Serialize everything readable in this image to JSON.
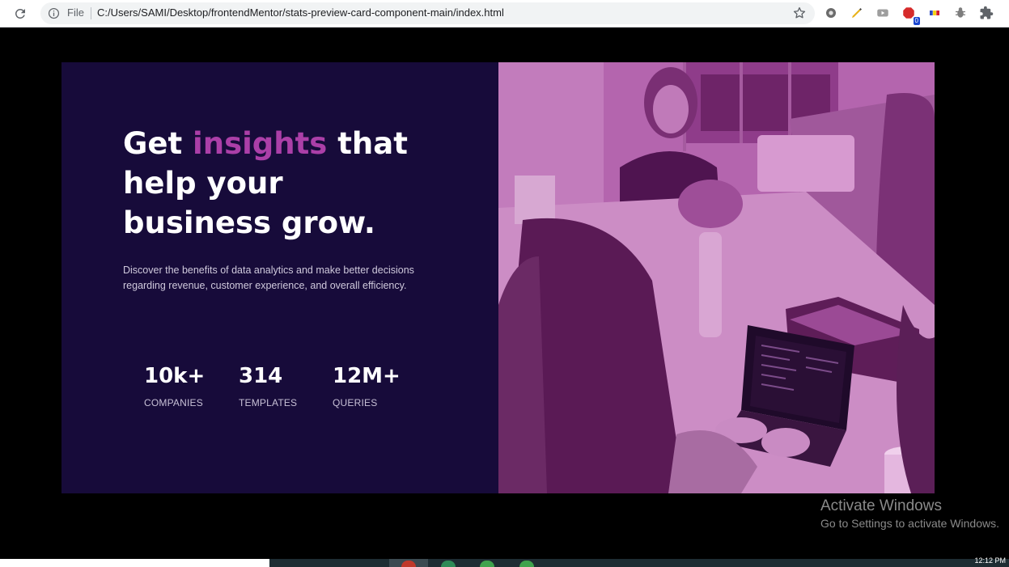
{
  "browser": {
    "file_label": "File",
    "url": "C:/Users/SAMI/Desktop/frontendMentor/stats-preview-card-component-main/index.html",
    "extension_badge": "0"
  },
  "card": {
    "headline_prefix": "Get ",
    "headline_accent": "insights",
    "headline_suffix": " that help your business grow.",
    "description": "Discover the benefits of data analytics and make better decisions regarding revenue, customer experience, and overall efficiency.",
    "stats": [
      {
        "value": "10k+",
        "label": "COMPANIES"
      },
      {
        "value": "314",
        "label": "TEMPLATES"
      },
      {
        "value": "12M+",
        "label": "QUERIES"
      }
    ],
    "colors": {
      "card_bg": "#170b3a",
      "accent": "#ab3fa8",
      "image_overlay": "#aa5ca5"
    }
  },
  "watermark": {
    "title": "Activate Windows",
    "subtitle": "Go to Settings to activate Windows."
  },
  "taskbar": {
    "clock": "12:12 PM"
  },
  "icons": {
    "reload": "reload-icon",
    "info": "info-icon",
    "star": "star-icon",
    "extensions": [
      "settings-extension-icon",
      "pencil-extension-icon",
      "youtube-extension-icon",
      "adblock-extension-icon",
      "flag-extension-icon",
      "bug-extension-icon",
      "puzzle-icon"
    ]
  }
}
